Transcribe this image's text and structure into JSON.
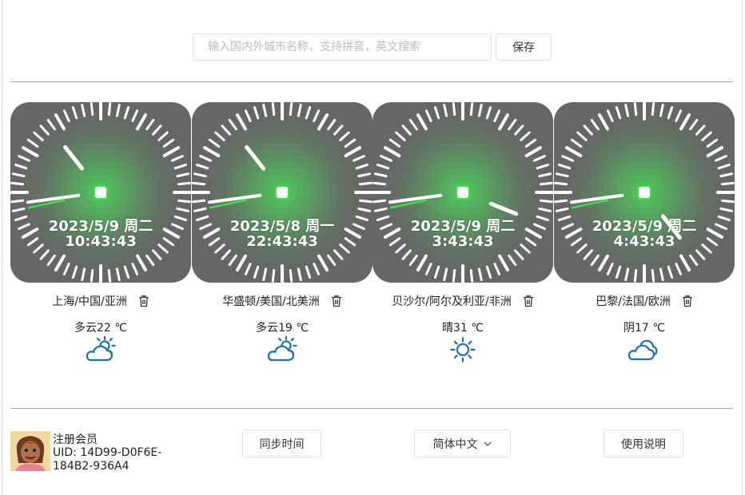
{
  "search": {
    "placeholder": "输入国内外城市名称，支持拼音，英文搜索",
    "value": ""
  },
  "toolbar": {
    "save_label": "保存"
  },
  "clocks": [
    {
      "date": "2023/5/9 周二",
      "time": "10:43:43",
      "city": "上海/中国/亚洲",
      "weather": "多云22 ℃",
      "weather_icon": "partly-cloudy-icon",
      "hands": {
        "hour": 10.73,
        "minute": 43.72,
        "second": 43
      }
    },
    {
      "date": "2023/5/8 周一",
      "time": "22:43:43",
      "city": "华盛顿/美国/北美洲",
      "weather": "多云19 ℃",
      "weather_icon": "partly-cloudy-icon",
      "hands": {
        "hour": 10.73,
        "minute": 43.72,
        "second": 43
      }
    },
    {
      "date": "2023/5/9 周二",
      "time": "3:43:43",
      "city": "贝沙尔/阿尔及利亚/非洲",
      "weather": "晴31 ℃",
      "weather_icon": "sunny-icon",
      "hands": {
        "hour": 3.73,
        "minute": 43.72,
        "second": 43
      }
    },
    {
      "date": "2023/5/9 周二",
      "time": "4:43:43",
      "city": "巴黎/法国/欧洲",
      "weather": "阴17 ℃",
      "weather_icon": "cloudy-icon",
      "hands": {
        "hour": 4.73,
        "minute": 43.72,
        "second": 43
      }
    }
  ],
  "footer": {
    "member_label": "注册会员",
    "uid": "UID: 14D99-D0F6E-184B2-936A4",
    "sync_label": "同步时间",
    "language_label": "简体中文",
    "help_label": "使用说明"
  },
  "colors": {
    "clock_face": "#666666",
    "clock_glow": "#4ccf5a",
    "second_hand": "#3fe04a",
    "tick": "#ffffff",
    "weather_icon": "#1f6fa8"
  }
}
